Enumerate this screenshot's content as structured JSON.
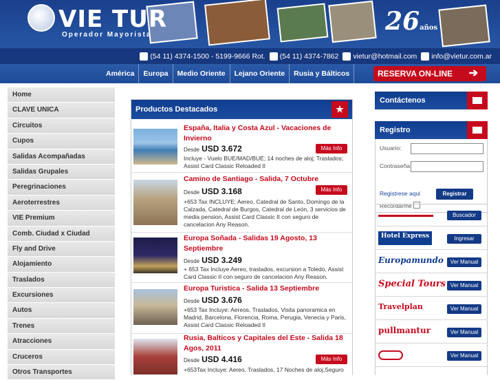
{
  "brand": {
    "name": "VIE TUR",
    "tagline": "Operador Mayorista",
    "anniversary": "26",
    "anniversary_word": "años"
  },
  "contact": {
    "phone1": "(54 11) 4374-1500 - 5199-9666 Rot.",
    "phone2": "(54 11) 4374-7862",
    "messenger": "vietur@hotmail.com",
    "email": "info@vietur.com.ar"
  },
  "nav": [
    "América",
    "Europa",
    "Medio Oriente",
    "Lejano Oriente",
    "Rusia y Bálticos"
  ],
  "reserve_label": "RESERVA ON-LINE",
  "sidebar": [
    "Home",
    "CLAVE UNICA",
    "Circuitos",
    "Cupos",
    "Salidas Acompañadas",
    "Salidas Grupales",
    "Peregrinaciones",
    "Aeroterrestres",
    "VIE Premium",
    "Comb. Ciudad x Ciudad",
    "Fly and Drive",
    "Alojamiento",
    "Traslados",
    "Excursiones",
    "Autos",
    "Trenes",
    "Atracciones",
    "Cruceros",
    "Otros Transportes"
  ],
  "products": {
    "header": "Productos Destacados",
    "more_label": "Más Info",
    "desde": "Desde",
    "items": [
      {
        "title": "España, Italia y Costa Azul - Vacaciones de Invierno",
        "price": "USD 3.672",
        "desc": "Incluye - Vuelo BUE/MAD/BUE; 14 noches de aloj; Traslados; Assist Card Classic Reloaded II"
      },
      {
        "title": "Camino de Santiago - Salida, 7 Octubre",
        "price": "USD 3.168",
        "desc": "+653 Tax INCLUYE: Aereo, Catedral de Santo, Domingo de la Calzada, Catedral de Burgos, Catedral de León, 3 servicios de media pension, Assist Card Classic II con seguro de cancelacion Any Reason."
      },
      {
        "title": "Europa Soñada - Salidas 19 Agosto, 13 Septiembre",
        "price": "USD 3.249",
        "desc": "+ 653 Tax Incluye Aereo, traslados, excursion a Toledo, Assist Card Classic II con seguro de cancelacion Any Reason."
      },
      {
        "title": "Europa Turistica - Salida 13 Septiembre",
        "price": "USD 3.676",
        "desc": "+653 Tax Incluye: Aereos, Traslados, Visita panoramica en Madrid, Barcelona, Florencia, Roma, Perugia, Venecia y Paris, Assist Card Classic Reloaded II"
      },
      {
        "title": "Rusia, Balticos y Capitales del Este - Salida 18 Agos, 2011",
        "price": "USD 4.416",
        "desc": "+653Tax Incluye: Aereo, Traslados, 17 Noches de aloj,Seguro"
      }
    ]
  },
  "contact_box": "Contáctenos",
  "login": {
    "title": "Registro",
    "user_label": "Usuario:",
    "pass_label": "Contraseña:",
    "register_link": "Registrese aqui",
    "button": "Registrar",
    "remember": "Recordarme"
  },
  "partners": [
    {
      "logo": "",
      "button": "Buscador"
    },
    {
      "logo": "Hotel Express",
      "button": "Ingresar"
    },
    {
      "logo": "Europamundo",
      "button": "Ver Manual"
    },
    {
      "logo": "Special Tours",
      "button": "Ver Manual"
    },
    {
      "logo": "Travelplan",
      "button": "Ver Manual"
    },
    {
      "logo": "pullmantur",
      "button": "Ver Manual"
    },
    {
      "logo": "",
      "button": "Ver Manual"
    }
  ]
}
